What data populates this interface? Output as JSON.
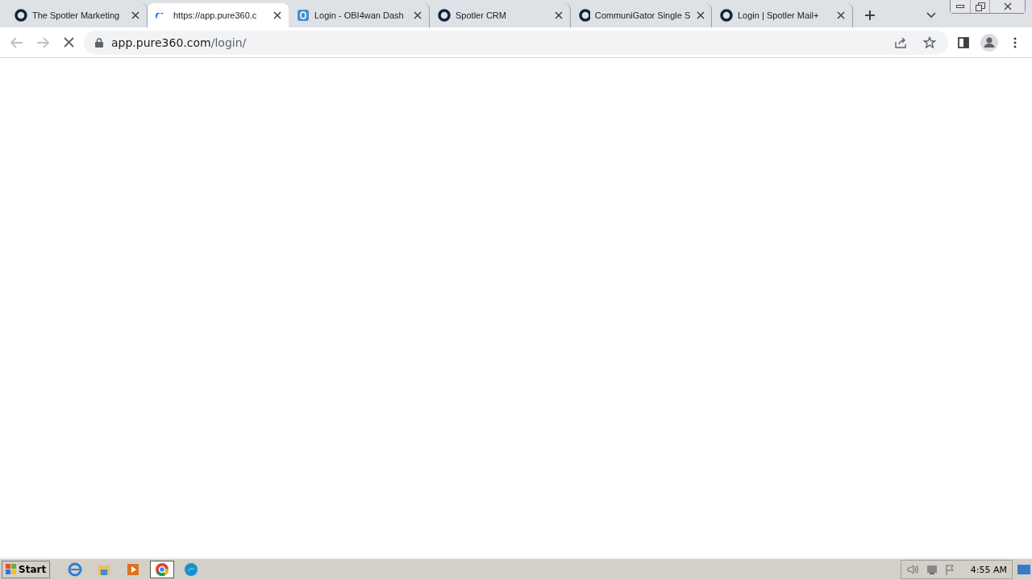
{
  "tabs": [
    {
      "title": "The Spotler Marketing",
      "kind": "ring",
      "selected": false
    },
    {
      "title": "https://app.pure360.c",
      "kind": "spinner",
      "selected": true
    },
    {
      "title": "Login - OBI4wan Dash",
      "kind": "square",
      "selected": false
    },
    {
      "title": "Spotler CRM",
      "kind": "ring",
      "selected": false
    },
    {
      "title": "CommuniGator Single S",
      "kind": "ring",
      "selected": false
    },
    {
      "title": "Login | Spotler Mail+",
      "kind": "ring",
      "selected": false
    }
  ],
  "address_bar": {
    "host": "app.pure360.com",
    "path": "/login/"
  },
  "taskbar": {
    "start": "Start",
    "apps": [
      {
        "kind": "ie",
        "selected": false
      },
      {
        "kind": "folder",
        "selected": false
      },
      {
        "kind": "media",
        "selected": false
      },
      {
        "kind": "chrome",
        "selected": true
      },
      {
        "kind": "edge",
        "selected": false
      }
    ],
    "clock": "4:55 AM"
  }
}
